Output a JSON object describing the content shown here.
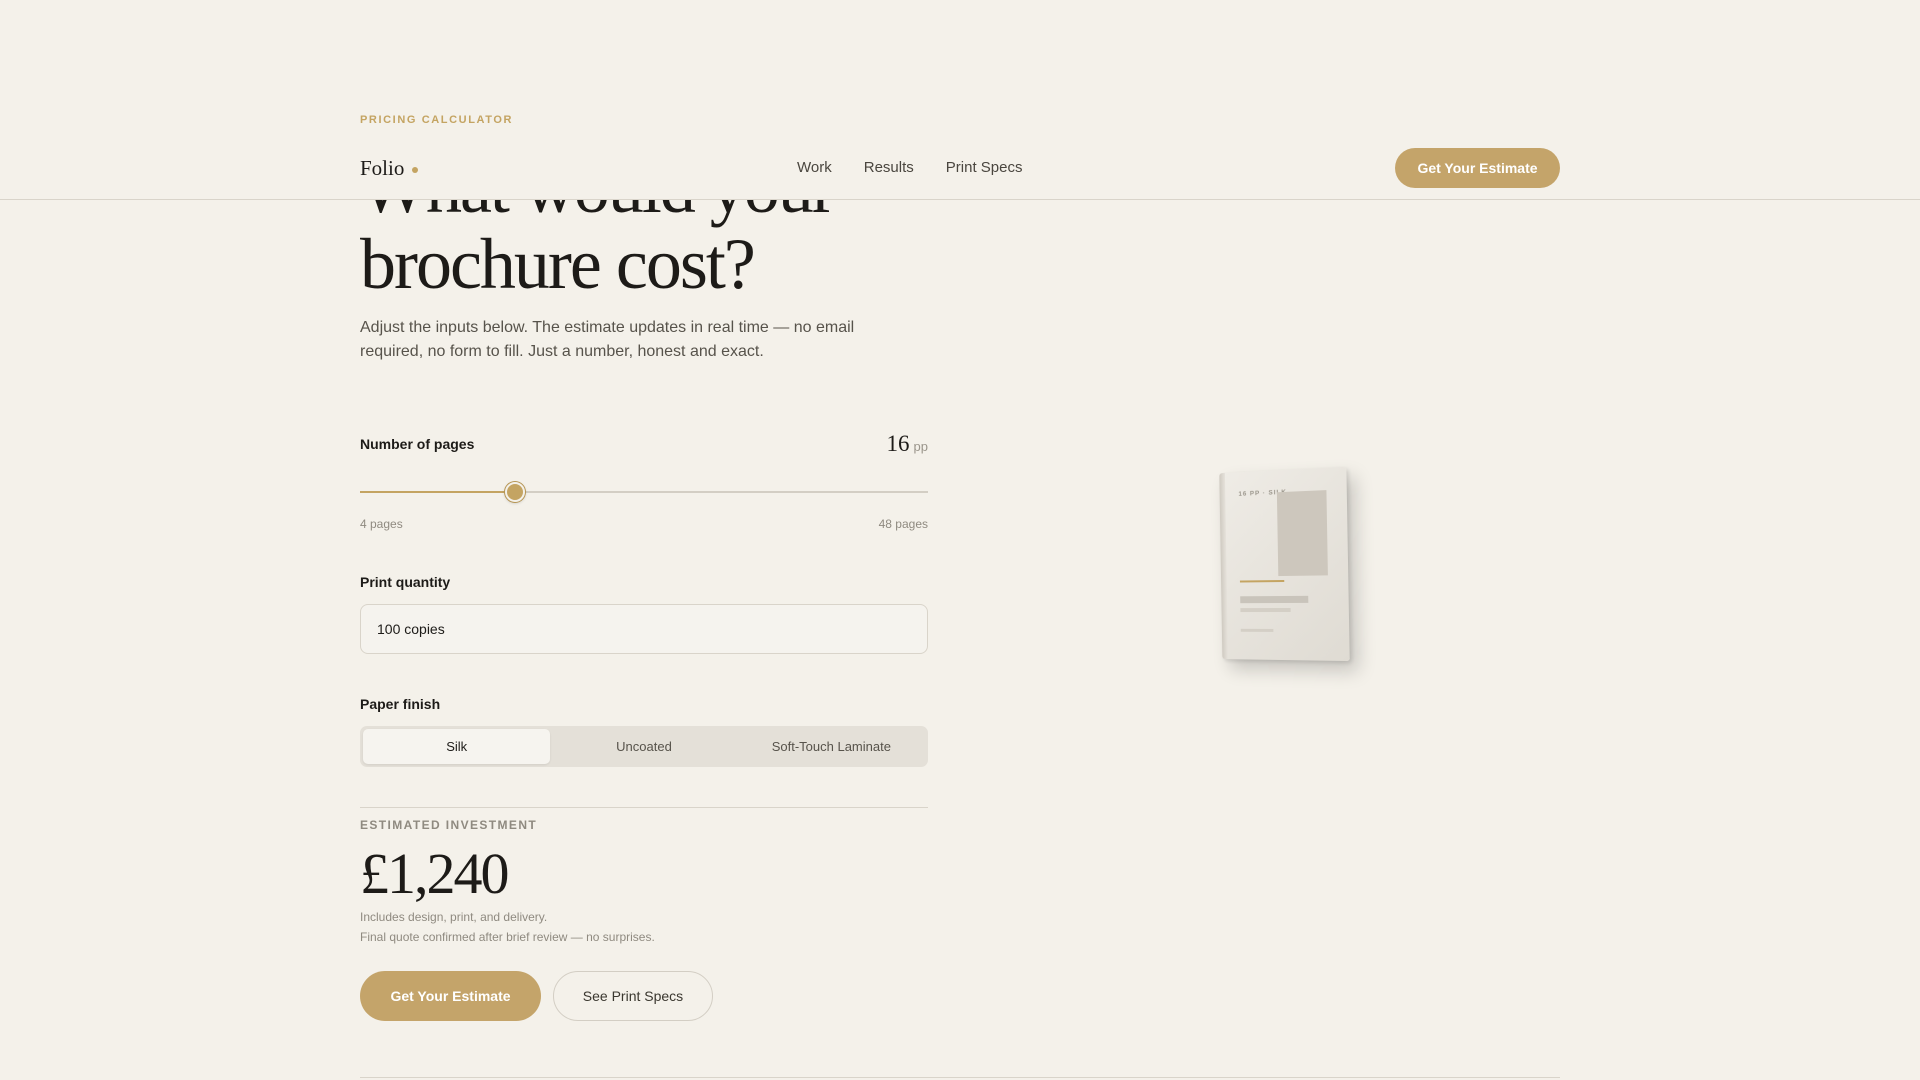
{
  "eyebrow": "PRICING CALCULATOR",
  "headline": {
    "line1": "What would your",
    "line2": "brochure cost?"
  },
  "nav": {
    "brand": "Folio",
    "links": [
      "Work",
      "Results",
      "Print Specs"
    ],
    "cta": "Get Your Estimate"
  },
  "lede": "Adjust the inputs below. The estimate updates in real time — no email required, no form to fill. Just a number, honest and exact.",
  "pages": {
    "label": "Number of pages",
    "value": "16",
    "unit": "pp",
    "min_label": "4 pages",
    "max_label": "48 pages",
    "min": 4,
    "max": 48,
    "current": 16
  },
  "quantity": {
    "label": "Print quantity",
    "value": "100 copies"
  },
  "finish": {
    "label": "Paper finish",
    "options": [
      "Silk",
      "Uncoated",
      "Soft-Touch Laminate"
    ],
    "selected": "Silk"
  },
  "estimate": {
    "label": "ESTIMATED INVESTMENT",
    "price": "£1,240",
    "note1": "Includes design, print, and delivery.",
    "note2": "Final quote confirmed after brief review — no surprises."
  },
  "actions": {
    "primary": "Get Your Estimate",
    "secondary": "See Print Specs"
  },
  "brochure": {
    "tag": "16 PP · SILK"
  },
  "colors": {
    "accent": "#c4a462",
    "background": "#f4f1ea",
    "text": "#1d1b18"
  }
}
